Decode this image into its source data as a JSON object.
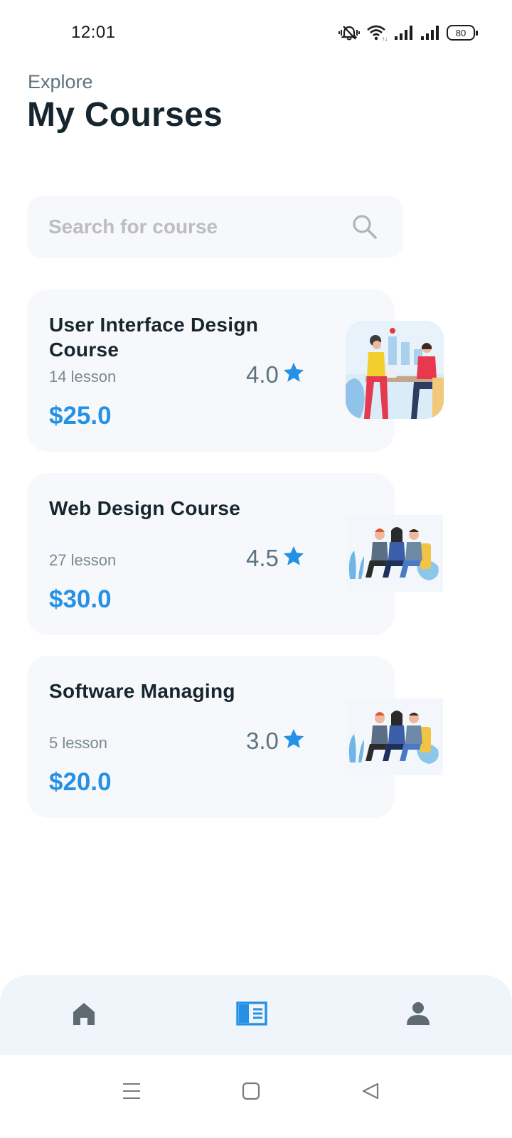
{
  "status_bar": {
    "time": "12:01",
    "battery": "80",
    "icons": [
      "mute-icon",
      "wifi-icon",
      "signal-icon",
      "signal-icon",
      "battery-icon"
    ]
  },
  "header": {
    "subtitle": "Explore",
    "title": "My Courses"
  },
  "search": {
    "placeholder": "Search for course",
    "value": "",
    "icon": "search-icon"
  },
  "courses": [
    {
      "title": "User Interface Design Course",
      "lessons": "14 lesson",
      "rating": "4.0",
      "price": "$25.0",
      "thumbnail": "meeting-illustration"
    },
    {
      "title": "Web Design Course",
      "lessons": "27 lesson",
      "rating": "4.5",
      "price": "$30.0",
      "thumbnail": "team-seated-illustration"
    },
    {
      "title": "Software Managing",
      "lessons": "5 lesson",
      "rating": "3.0",
      "price": "$20.0",
      "thumbnail": "team-seated-illustration"
    }
  ],
  "bottom_nav": {
    "items": [
      {
        "name": "home",
        "icon": "home-icon",
        "active": false
      },
      {
        "name": "courses",
        "icon": "book-open-icon",
        "active": true
      },
      {
        "name": "profile",
        "icon": "person-icon",
        "active": false
      }
    ]
  },
  "system_nav": [
    "menu-icon",
    "home-square-icon",
    "back-triangle-icon"
  ],
  "colors": {
    "accent": "#2591e5",
    "title": "#17262e",
    "muted": "#5d7480",
    "card_bg": "#f6f8fb",
    "nav_bg": "#eff5fb",
    "inactive_icon": "#5f6a72"
  }
}
